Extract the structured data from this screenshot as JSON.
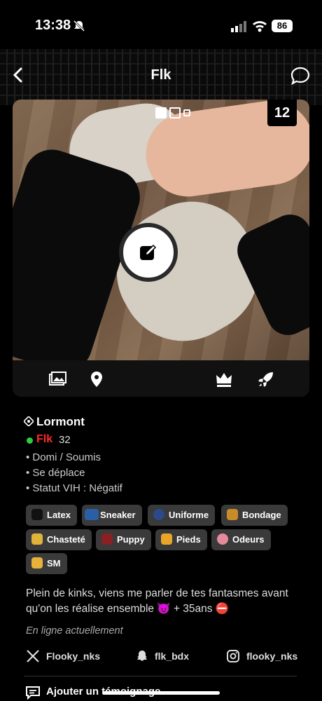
{
  "status_bar": {
    "time": "13:38",
    "battery": "86"
  },
  "header": {
    "title": "Flk"
  },
  "gallery": {
    "photo_count": "12"
  },
  "profile": {
    "location": "Lormont",
    "name": "Flk",
    "age": "32",
    "attributes": [
      "• Domi / Soumis",
      "• Se déplace",
      "• Statut VIH : Négatif"
    ],
    "tags": [
      "Latex",
      "Sneaker",
      "Uniforme",
      "Bondage",
      "Chasteté",
      "Puppy",
      "Pieds",
      "Odeurs",
      "SM"
    ],
    "bio": "Plein de kinks, viens me parler de tes fantasmes avant qu'on les réalise ensemble 😈 + 35ans ⛔",
    "online_status": "En ligne actuellement"
  },
  "socials": {
    "x": "Flooky_nks",
    "snapchat": "flk_bdx",
    "instagram": "flooky_nks"
  },
  "actions": {
    "testimonial": "Ajouter un témoignage"
  },
  "colors": {
    "online": "#2ecc40",
    "name": "#ff2a2a",
    "tag_bg": "#3a3a3a"
  }
}
